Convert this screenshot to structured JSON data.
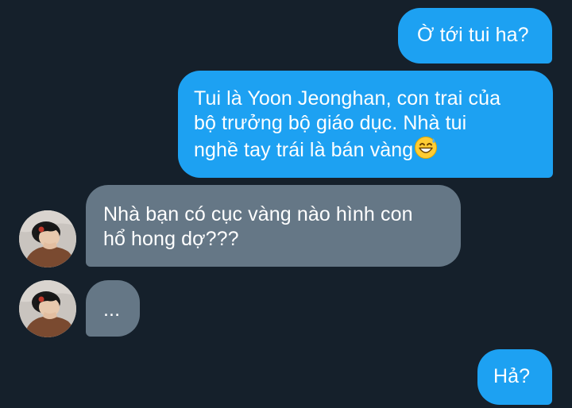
{
  "conversation": {
    "messages": [
      {
        "sender": "me",
        "lines": [
          "Ờ tới tui ha?"
        ]
      },
      {
        "sender": "me",
        "lines": [
          "Tui là Yoon Jeonghan, con trai của",
          "bộ trưởng bộ giáo dục. Nhà tui",
          "nghề tay trái là bán vàng"
        ],
        "emoji": "grinning-face-with-sweat-icon"
      },
      {
        "sender": "other",
        "lines": [
          "Nhà bạn có cục vàng nào hình con",
          "hổ hong dợ???"
        ]
      },
      {
        "sender": "other",
        "lines": [
          "..."
        ]
      },
      {
        "sender": "me",
        "lines": [
          "Hả?"
        ]
      }
    ]
  },
  "colors": {
    "background": "#15202b",
    "sent_bubble": "#1da1f2",
    "received_bubble": "#657786",
    "text": "#ffffff"
  }
}
